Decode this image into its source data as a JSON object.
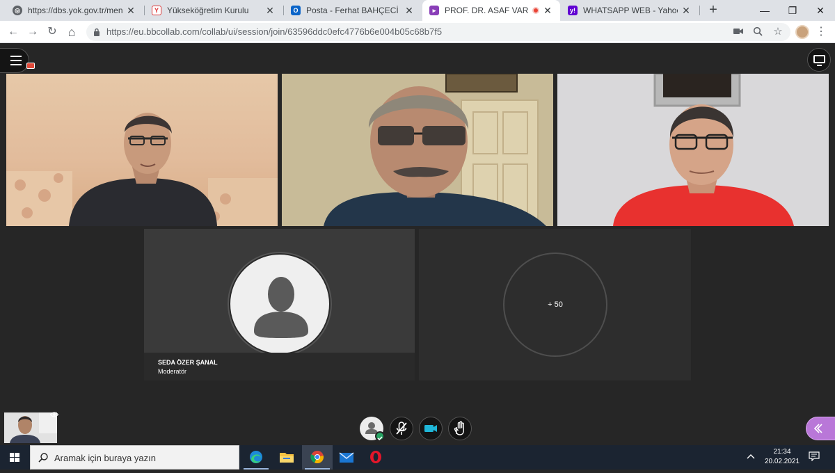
{
  "browser": {
    "tabs": [
      {
        "title": "https://dbs.yok.gov.tr/menu/m",
        "icon": "globe-icon",
        "active": false
      },
      {
        "title": "Yükseköğretim Kurulu",
        "icon": "yok-logo-icon",
        "active": false
      },
      {
        "title": "Posta - Ferhat BAHÇECİ - Outlo",
        "icon": "outlook-icon",
        "active": false
      },
      {
        "title": "PROF. DR. ASAF VAROL İLE",
        "icon": "collaborate-icon",
        "active": true,
        "recording": true
      },
      {
        "title": "WHATSAPP WEB - Yahoo Turki",
        "icon": "yahoo-icon",
        "active": false
      }
    ],
    "new_tab": "+",
    "window_controls": {
      "minimize": "—",
      "restore": "❐",
      "close": "✕"
    },
    "url": "https://eu.bbcollab.com/collab/ui/session/join/63596ddc0efc4776b6e004b05c68b7f5",
    "nav": {
      "back": "←",
      "forward": "→",
      "reload": "↻",
      "home": "⌂"
    },
    "omnibox_icons": [
      "camera-icon",
      "zoom-icon",
      "star-icon"
    ],
    "menu": "⋮"
  },
  "session": {
    "participant_name": "SEDA ÖZER ŞANAL",
    "participant_role": "Moderatör",
    "more_count": "+ 50",
    "controls": [
      "status-icon",
      "mic-muted-icon",
      "camera-icon",
      "raise-hand-icon"
    ],
    "colors": {
      "background": "#262626",
      "accent": "#b977d8",
      "status_ok": "#27a563"
    }
  },
  "taskbar": {
    "search_placeholder": "Aramak için buraya yazın",
    "apps": [
      "edge-icon",
      "file-explorer-icon",
      "chrome-icon",
      "mail-icon",
      "opera-icon"
    ],
    "time": "21:34",
    "date": "20.02.2021",
    "tray_chevron": "^"
  }
}
